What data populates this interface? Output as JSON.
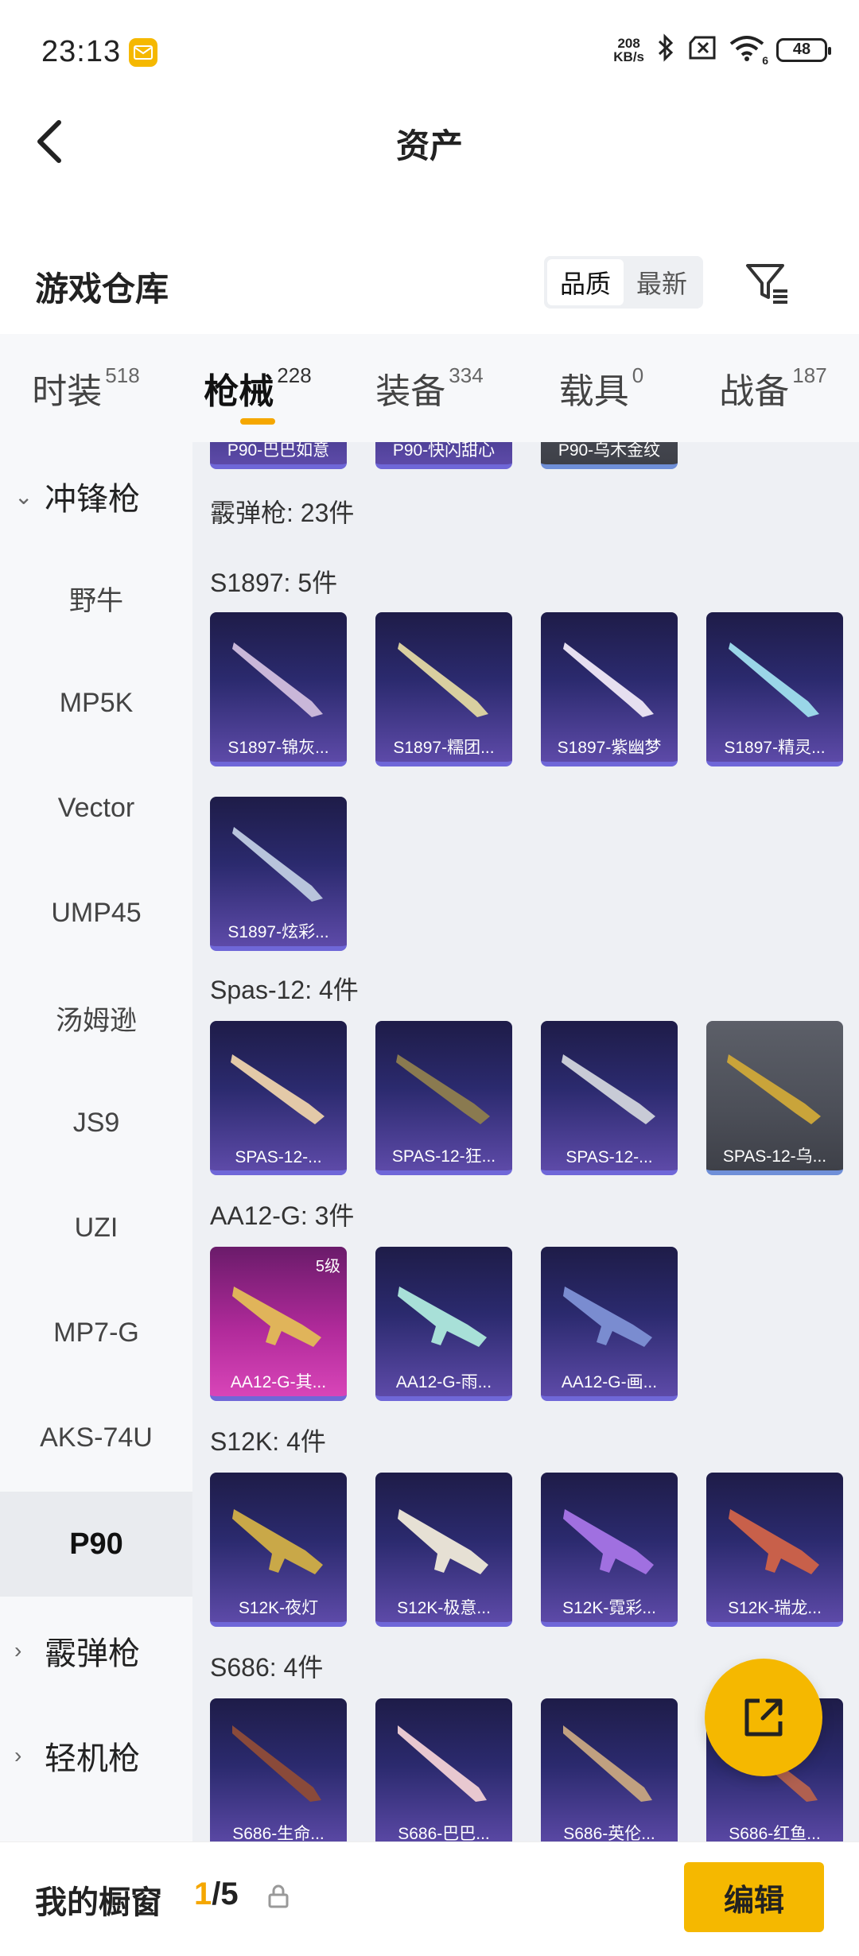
{
  "status": {
    "time": "23:13",
    "net_speed_top": "208",
    "net_speed_bottom": "KB/s",
    "wifi_sub": "6",
    "battery": "48"
  },
  "header": {
    "title": "资产"
  },
  "warehouse": {
    "title": "游戏仓库",
    "sort_quality": "品质",
    "sort_newest": "最新"
  },
  "tabs": [
    {
      "label": "时装",
      "count": "518"
    },
    {
      "label": "枪械",
      "count": "228"
    },
    {
      "label": "装备",
      "count": "334"
    },
    {
      "label": "载具",
      "count": "0"
    },
    {
      "label": "战备",
      "count": "187"
    }
  ],
  "sidebar": {
    "category_open": "冲锋枪",
    "items": [
      "野牛",
      "MP5K",
      "Vector",
      "UMP45",
      "汤姆逊",
      "JS9",
      "UZI",
      "MP7-G",
      "AKS-74U",
      "P90"
    ],
    "category_2": "霰弹枪",
    "category_3": "轻机枪"
  },
  "content": {
    "top_row": [
      "P90-巴巴如意",
      "P90-快闪甜心",
      "P90-乌木金纹"
    ],
    "category_header": "霰弹枪: 23件",
    "groups": [
      {
        "title": "S1897: 5件",
        "items": [
          "S1897-锦灰...",
          "S1897-糯团...",
          "S1897-紫幽梦",
          "S1897-精灵...",
          "S1897-炫彩..."
        ]
      },
      {
        "title": "Spas-12: 4件",
        "items": [
          "SPAS-12-...",
          "SPAS-12-狂...",
          "SPAS-12-...",
          "SPAS-12-乌..."
        ]
      },
      {
        "title": "AA12-G: 3件",
        "items": [
          "AA12-G-其...",
          "AA12-G-雨...",
          "AA12-G-画..."
        ],
        "level_badge": "5级"
      },
      {
        "title": "S12K: 4件",
        "items": [
          "S12K-夜灯",
          "S12K-极意...",
          "S12K-霓彩...",
          "S12K-瑞龙..."
        ]
      },
      {
        "title": "S686: 4件",
        "items": [
          "S686-生命...",
          "S686-巴巴...",
          "S686-英伦...",
          "S686-红鱼..."
        ]
      }
    ]
  },
  "bottom": {
    "label": "我的橱窗",
    "current": "1",
    "total": "/5",
    "edit": "编辑"
  },
  "colors": {
    "accent": "#f5b800",
    "card_bg": "#2b2a6e"
  }
}
